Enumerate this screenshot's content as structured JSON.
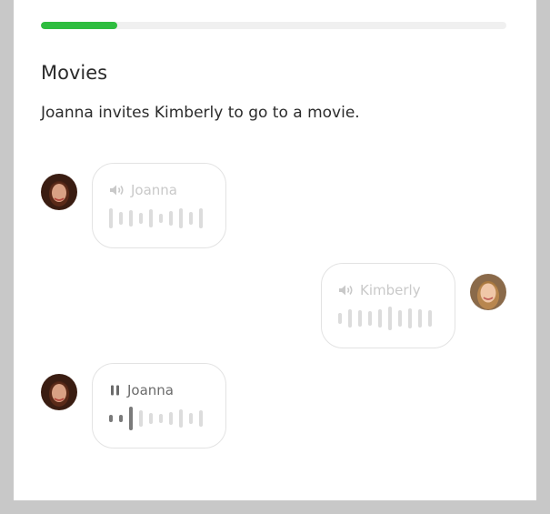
{
  "progress": {
    "fraction": 0.165,
    "fill_color": "#2ebd3f"
  },
  "lesson": {
    "title": "Movies",
    "description": "Joanna invites Kimberly to go to a movie."
  },
  "messages": [
    {
      "speaker": "Joanna",
      "side": "left",
      "state": "unplayed",
      "icon": "speaker-icon"
    },
    {
      "speaker": "Kimberly",
      "side": "right",
      "state": "unplayed",
      "icon": "speaker-icon"
    },
    {
      "speaker": "Joanna",
      "side": "left",
      "state": "playing",
      "icon": "pause-icon"
    }
  ],
  "colors": {
    "muted": "#c9c9c9",
    "active": "#6b6b6b",
    "played_bar": "#7a7a7a",
    "bubble_border": "#e3e3e3"
  }
}
